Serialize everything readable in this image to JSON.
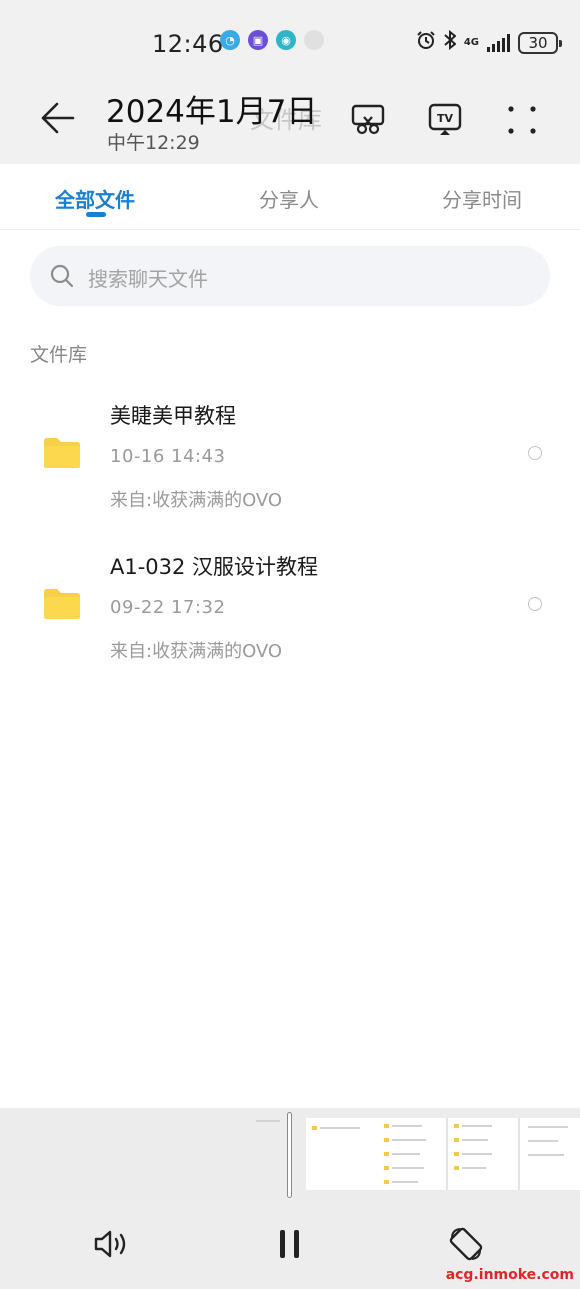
{
  "status_bar": {
    "time": "12:46",
    "network": "4G",
    "battery": "30"
  },
  "header": {
    "title": "2024年1月7日",
    "subtitle": "中午12:29",
    "ghost_title": "文件库"
  },
  "tabs": [
    {
      "label": "全部文件",
      "active": true
    },
    {
      "label": "分享人",
      "active": false
    },
    {
      "label": "分享时间",
      "active": false
    }
  ],
  "search": {
    "placeholder": "搜索聊天文件"
  },
  "section_label": "文件库",
  "files": [
    {
      "name": "美睫美甲教程",
      "time": "10-16  14:43",
      "from": "来自:收获满满的OVO"
    },
    {
      "name": "A1-032 汉服设计教程",
      "time": "09-22  17:32",
      "from": "来自:收获满满的OVO"
    }
  ],
  "watermark": "acg.inmoke.com",
  "colors": {
    "accent": "#1a7fd0",
    "folder": "#f7cf48",
    "background": "#ffffff",
    "header_bg": "#f1f1f1"
  }
}
